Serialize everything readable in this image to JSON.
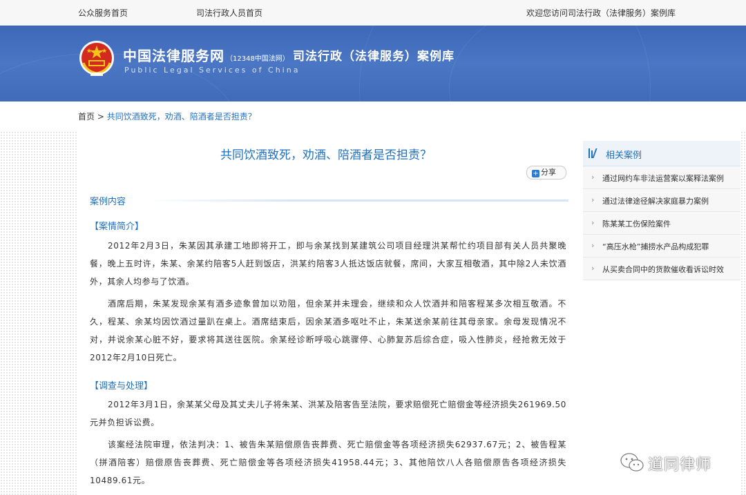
{
  "topbar": {
    "public_home": "公众服务首页",
    "staff_home": "司法行政人员首页",
    "welcome": "欢迎您访问司法行政（法律服务）案例库"
  },
  "banner": {
    "site_name_cn": "中国法律服务网",
    "hotline": "（12348中国法网）",
    "site_name_en": "Public Legal Services of China",
    "section_title": "司法行政（法律服务）案例库"
  },
  "breadcrumb": {
    "home": "首页",
    "separator": " > ",
    "current": "共同饮酒致死，劝酒、陪酒者是否担责？"
  },
  "article": {
    "title": "共同饮酒致死，劝酒、陪酒者是否担责？",
    "share_label": "分享",
    "section_label": "案例内容",
    "heading_brief": "【案情简介】",
    "para1": "2012年2月3日，朱某因其承建工地即将开工，即与余某找到某建筑公司项目经理洪某帮忙约项目部有关人员共聚晚餐，晚上五时许，朱某、余某约陪客5人赶到饭店，洪某约陪客3人抵达饭店就餐，席间，大家互相敬酒，其中除2人未饮酒外，其余人均参与了饮酒。",
    "para2": "酒席后期，朱某发现余某有酒多迹象曾加以劝阻，但余某并未理会，继续和众人饮酒并和陪客程某多次相互敬酒。不久，程某、余某均因饮酒过量趴在桌上。酒席结束后，因余某酒多呕吐不止，朱某送余某前往其母亲家。余母发现情况不对，并说余某心脏不好，要求将其送往医院。余某经诊断呼吸心跳骤停、心肺复苏后综合症，吸入性肺炎，经抢救无效于2012年2月10日死亡。",
    "heading_investigation": "【调查与处理】",
    "para3": "2012年3月1日，余某某父母及其丈夫儿子将朱某、洪某及陪客告至法院，要求赔偿死亡赔偿金等经济损失261969.50元并负担诉讼费。",
    "para4": "该案经法院审理，依法判决：1、被告朱某赔偿原告丧葬费、死亡赔偿金等各项经济损失62937.67元；2、被告程某（拼酒陪客）赔偿原告丧葬费、死亡赔偿金等各项经济损失41958.44元；3、其他陪饮八人各赔偿原告各项经济损失10489.61元。"
  },
  "sidebar": {
    "title": "相关案例",
    "items": [
      {
        "label": "通过网约车非法运营案以案释法案例"
      },
      {
        "label": "通过法律途径解决家庭暴力案例"
      },
      {
        "label": "陈某某工伤保险案件"
      },
      {
        "label": "“高压水枪”捕捞水产品构成犯罪"
      },
      {
        "label": "从买卖合同中的货款催收看诉讼时效"
      }
    ]
  },
  "watermark": {
    "text": "道同律师"
  },
  "colors": {
    "accent": "#1f6fc0",
    "banner": "#4a76c4",
    "sidebar_bg": "#f7f7f7"
  }
}
